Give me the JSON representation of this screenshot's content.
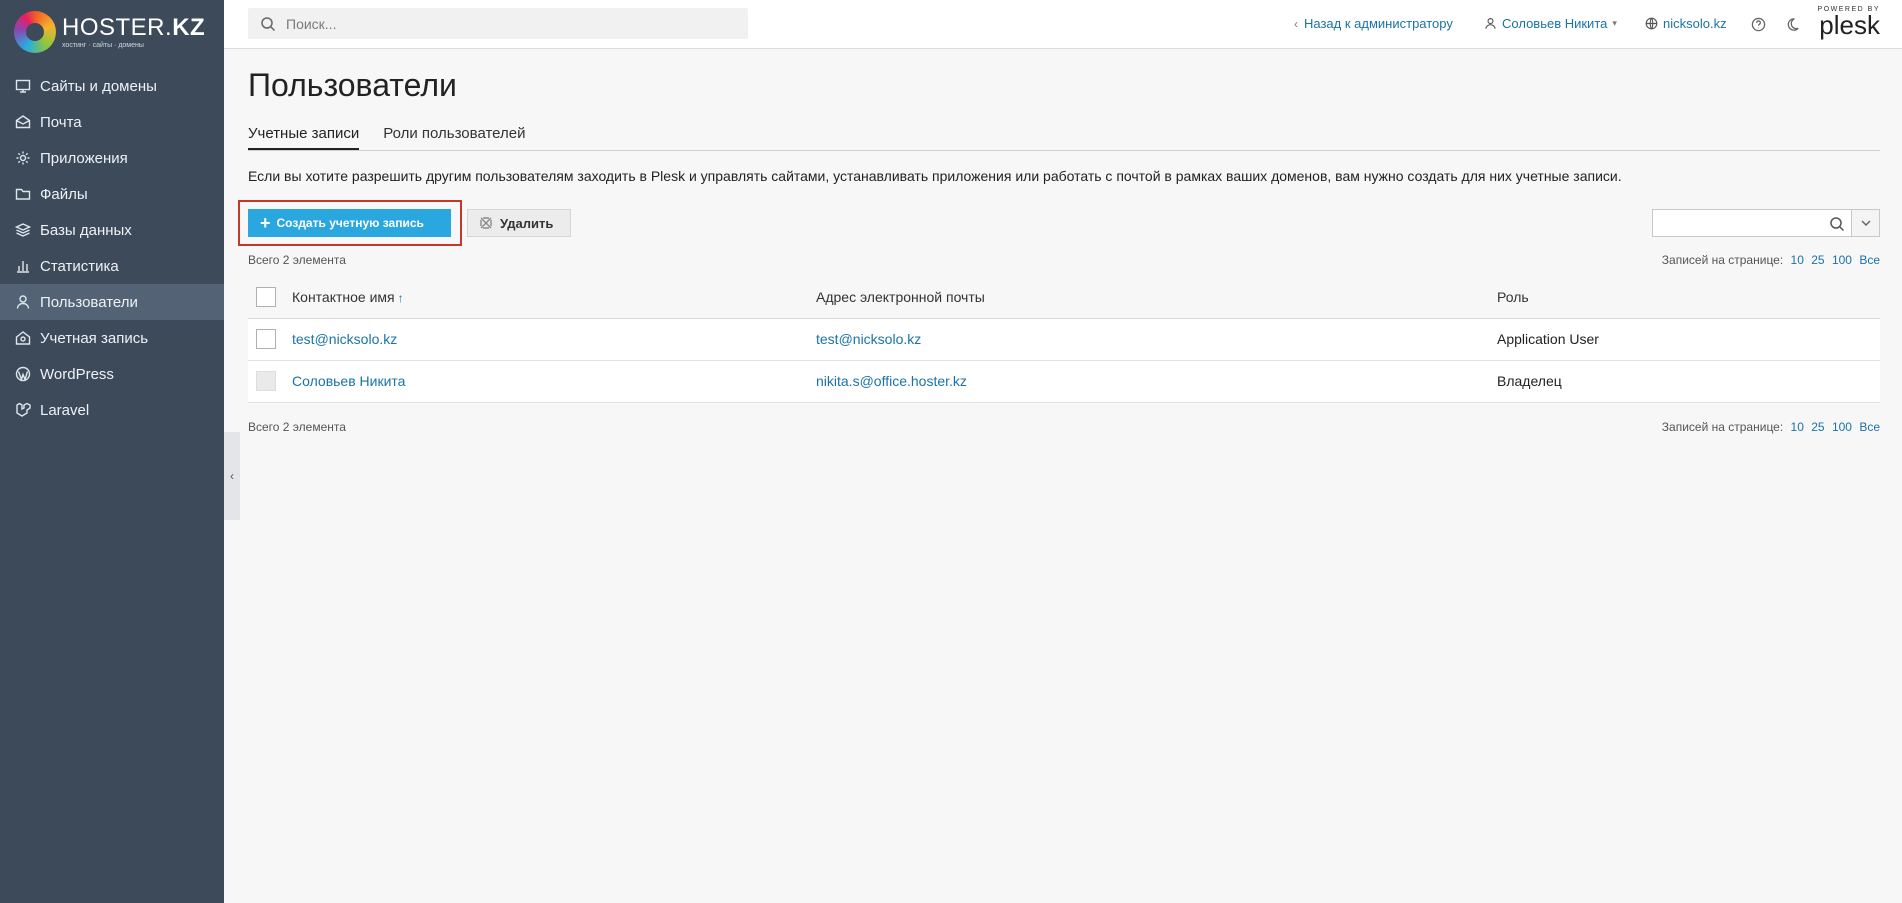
{
  "brand": {
    "name_light": "HOSTER.",
    "name_bold": "KZ",
    "tagline": "хостинг · сайты · домены"
  },
  "sidebar": {
    "items": [
      {
        "label": "Сайты и домены",
        "icon": "monitor-icon"
      },
      {
        "label": "Почта",
        "icon": "mail-icon"
      },
      {
        "label": "Приложения",
        "icon": "gear-icon"
      },
      {
        "label": "Файлы",
        "icon": "folder-icon"
      },
      {
        "label": "Базы данных",
        "icon": "layers-icon"
      },
      {
        "label": "Статистика",
        "icon": "bar-chart-icon"
      },
      {
        "label": "Пользователи",
        "icon": "user-icon",
        "active": true
      },
      {
        "label": "Учетная запись",
        "icon": "account-icon"
      },
      {
        "label": "WordPress",
        "icon": "wordpress-icon"
      },
      {
        "label": "Laravel",
        "icon": "laravel-icon"
      }
    ]
  },
  "topbar": {
    "search_placeholder": "Поиск...",
    "back_to_admin": "Назад к администратору",
    "user_name": "Соловьев Никита",
    "domain": "nicksolo.kz",
    "powered_by": "POWERED BY",
    "plesk": "plesk"
  },
  "main": {
    "title": "Пользователи",
    "tabs": [
      {
        "label": "Учетные записи",
        "active": true
      },
      {
        "label": "Роли пользователей",
        "active": false
      }
    ],
    "hint": "Если вы хотите разрешить другим пользователям заходить в Plesk и управлять сайтами, устанавливать приложения или работать с почтой в рамках ваших доменов, вам нужно создать для них учетные записи.",
    "create_button": "Создать учетную запись",
    "delete_button": "Удалить",
    "total": "Всего 2 элемента",
    "per_page_label": "Записей на странице:",
    "per_page_options": [
      "10",
      "25",
      "100",
      "Все"
    ],
    "table": {
      "columns": [
        "Контактное имя",
        "Адрес электронной почты",
        "Роль"
      ],
      "sort_indicator": "↑",
      "rows": [
        {
          "name": "test@nicksolo.kz",
          "email": "test@nicksolo.kz",
          "role": "Application User",
          "selectable": true
        },
        {
          "name": "Соловьев Никита",
          "email": "nikita.s@office.hoster.kz",
          "role": "Владелец",
          "selectable": false
        }
      ]
    }
  },
  "colors": {
    "sidebar_bg": "#3c4a5a",
    "accent": "#2aa7df",
    "link": "#1a73a8",
    "highlight_border": "#c0392b"
  }
}
